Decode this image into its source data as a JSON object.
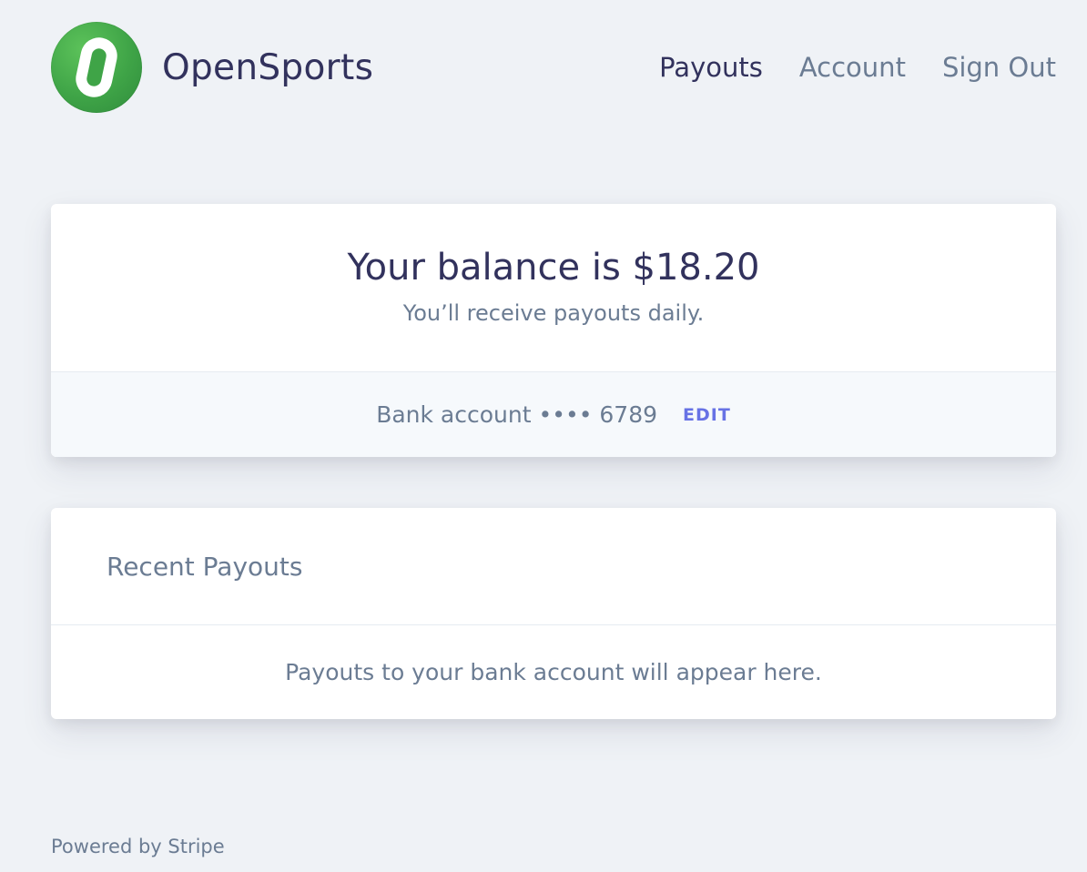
{
  "brand": {
    "name": "OpenSports",
    "logo_icon": "opensports-logo-icon",
    "logo_color": "#3fa447"
  },
  "nav": {
    "items": [
      {
        "label": "Payouts",
        "active": true
      },
      {
        "label": "Account",
        "active": false
      },
      {
        "label": "Sign Out",
        "active": false
      }
    ]
  },
  "balance": {
    "title": "Your balance is $18.20",
    "subtitle": "You’ll receive payouts daily.",
    "bank_account": "Bank account •••• 6789",
    "edit_label": "EDIT"
  },
  "recent_payouts": {
    "title": "Recent Payouts",
    "empty_message": "Payouts to your bank account will appear here."
  },
  "footer": {
    "text": "Powered by Stripe"
  },
  "colors": {
    "background": "#eff2f6",
    "heading": "#32325d",
    "muted": "#6b7c93",
    "accent": "#6772e5"
  }
}
